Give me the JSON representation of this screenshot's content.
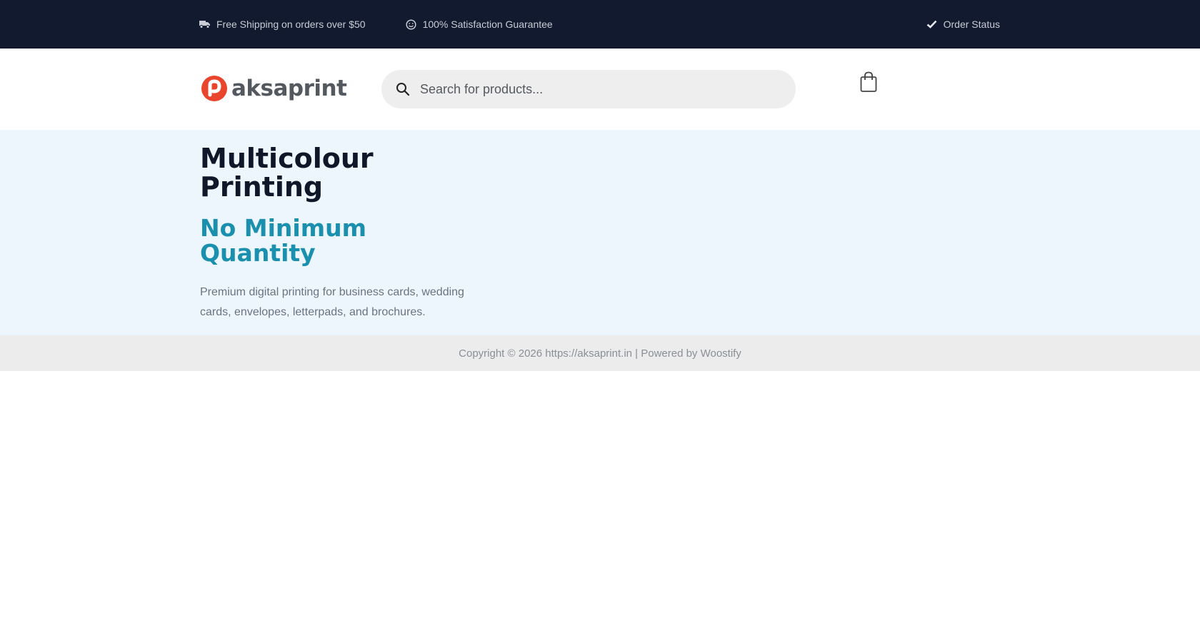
{
  "topbar": {
    "shipping_text": "Free Shipping on orders over $50",
    "guarantee_text": "100% Satisfaction Guarantee",
    "order_status_text": "Order Status",
    "icons": {
      "shipping": "truck-icon",
      "guarantee": "smile-icon",
      "order_status": "check-icon"
    }
  },
  "header": {
    "logo_text": "aksaprint",
    "search": {
      "placeholder": "Search for products...",
      "value": ""
    },
    "icons": {
      "search": "search-icon",
      "cart": "shopping-bag-icon"
    }
  },
  "hero": {
    "title": "Multicolour Printing",
    "subtitle": "No Minimum Quantity",
    "description": "Premium digital printing for business cards, wedding cards, envelopes, letterpads, and brochures."
  },
  "footer": {
    "copyright": "Copyright © 2026 https://aksaprint.in | Powered by Woostify"
  },
  "colors": {
    "topbar_bg": "#111a2e",
    "hero_bg": "#eef6fd",
    "title": "#0f1729",
    "accent": "#1b8fae",
    "logo_red": "#e8452c"
  }
}
